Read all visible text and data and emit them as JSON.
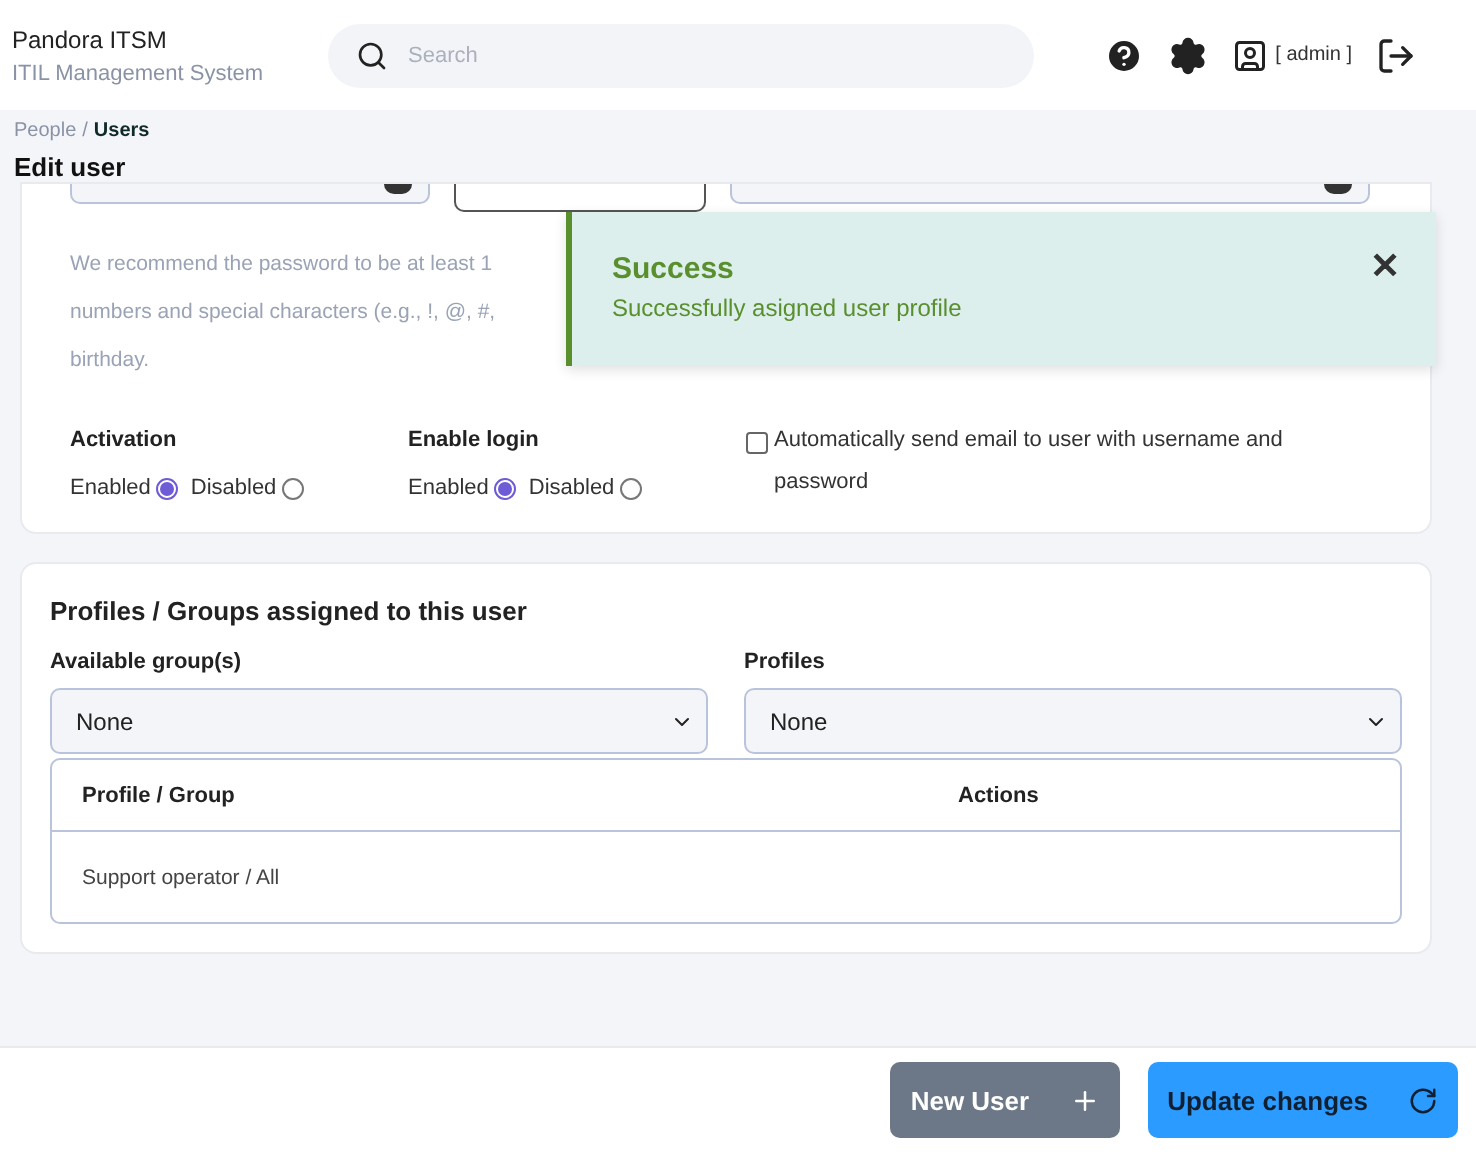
{
  "header": {
    "app_name": "Pandora ITSM",
    "app_subtitle": "ITIL Management System",
    "search": {
      "placeholder": "Search"
    },
    "user": "[ admin ]"
  },
  "breadcrumb": {
    "parent": "People",
    "separator": "/",
    "current": "Users"
  },
  "title": "Edit user",
  "password_hint": [
    "We recommend the password to be at least 1",
    "numbers and special characters (e.g., !, @, #,",
    "birthday."
  ],
  "toast": {
    "title": "Success",
    "message": "Successfully asigned user profile",
    "close": "✕"
  },
  "radio_groups": [
    {
      "label": "Activation",
      "options": [
        {
          "label": "Enabled",
          "selected": true
        },
        {
          "label": "Disabled",
          "selected": false
        }
      ]
    },
    {
      "label": "Enable login",
      "options": [
        {
          "label": "Enabled",
          "selected": true
        },
        {
          "label": "Disabled",
          "selected": false
        }
      ]
    }
  ],
  "send_email": {
    "label": "Automatically send email to user with username and password",
    "checked": false
  },
  "profiles": {
    "title": "Profiles / Groups assigned to this user",
    "selects": [
      {
        "label": "Available group(s)",
        "value": "None"
      },
      {
        "label": "Profiles",
        "value": "None"
      }
    ],
    "table": {
      "columns": [
        "Profile / Group",
        "Actions"
      ],
      "rows": [
        [
          "Support operator / All",
          ""
        ]
      ]
    }
  },
  "footer": {
    "buttons": [
      {
        "label": "New User",
        "kind": "new"
      },
      {
        "label": "Update changes",
        "kind": "update"
      }
    ]
  }
}
